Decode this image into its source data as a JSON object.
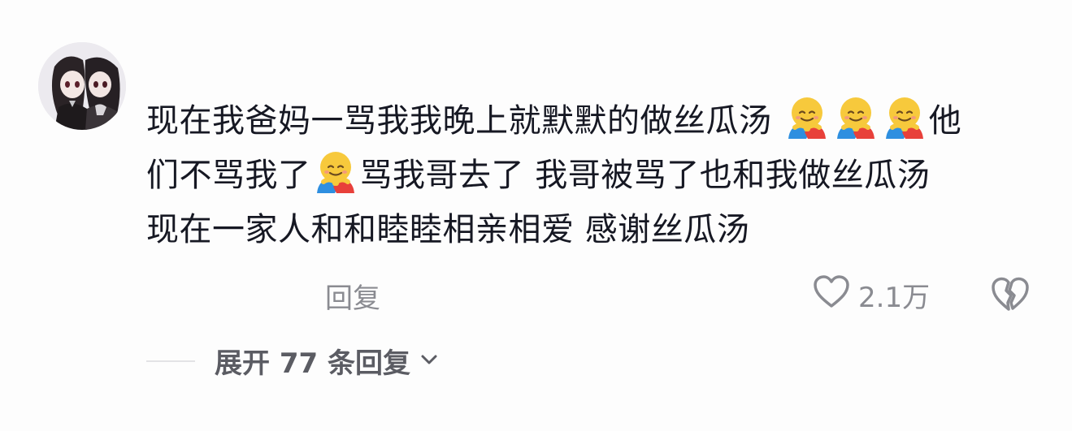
{
  "comment": {
    "line1": {
      "text_before": "现在我爸妈一骂我我晚上就默默的做丝瓜汤",
      "text_after": "他"
    },
    "line2": {
      "text_before": "们不骂我了",
      "text_after": "骂我哥去了 我哥被骂了也和我做丝瓜汤"
    },
    "line3": {
      "text": "现在一家人和和睦睦相亲相爱 感谢丝瓜汤"
    },
    "emoji": "hugging-face"
  },
  "actions": {
    "reply_label": "回复",
    "like_count": "2.1万"
  },
  "expand": {
    "label": "展开 77 条回复"
  },
  "colors": {
    "text": "#161823",
    "muted": "#8a8b91",
    "expand": "#5b5c63"
  }
}
